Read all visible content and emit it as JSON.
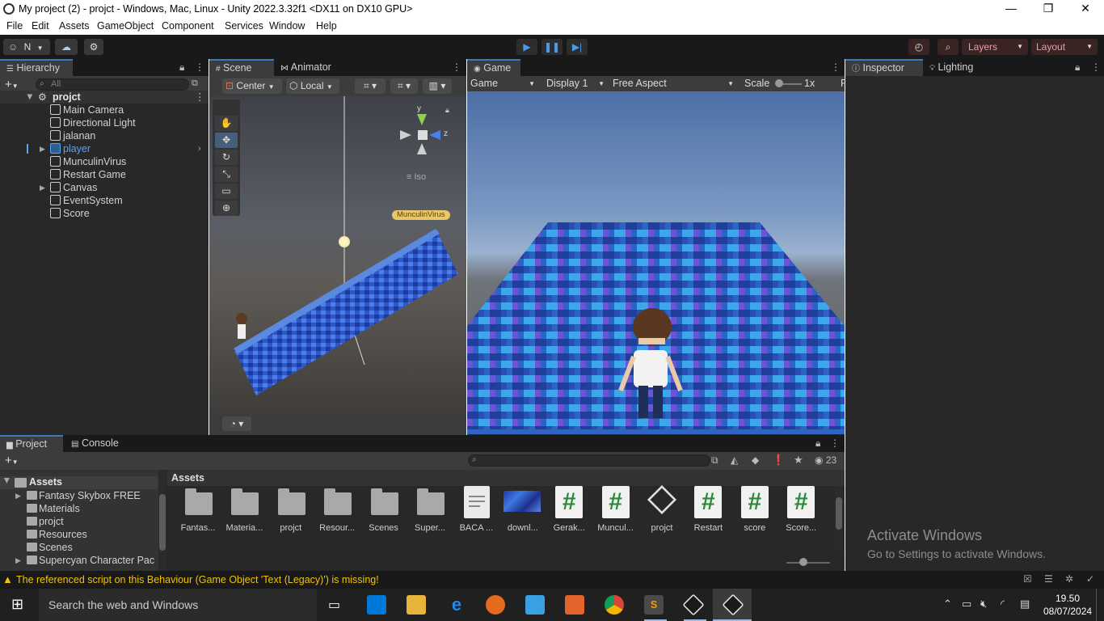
{
  "window": {
    "title": "My project (2) - projct - Windows, Mac, Linux - Unity 2022.3.32f1 <DX11 on DX10 GPU>",
    "minimize": "—",
    "maximize": "❐",
    "close": "✕"
  },
  "menu": [
    "File",
    "Edit",
    "Assets",
    "GameObject",
    "Component",
    "Services",
    "Window",
    "Help"
  ],
  "toolbar": {
    "account_initial": "N",
    "layers_label": "Layers",
    "layout_label": "Layout"
  },
  "hierarchy": {
    "tab": "Hierarchy",
    "search_placeholder": "All",
    "scene_name": "projct",
    "items": [
      {
        "label": "Main Camera",
        "selected": false,
        "expandable": false
      },
      {
        "label": "Directional Light",
        "selected": false,
        "expandable": false
      },
      {
        "label": "jalanan",
        "selected": false,
        "expandable": false
      },
      {
        "label": "player",
        "selected": true,
        "expandable": true
      },
      {
        "label": "MunculinVirus",
        "selected": false,
        "expandable": false
      },
      {
        "label": "Restart Game",
        "selected": false,
        "expandable": false
      },
      {
        "label": "Canvas",
        "selected": false,
        "expandable": true
      },
      {
        "label": "EventSystem",
        "selected": false,
        "expandable": false
      },
      {
        "label": "Score",
        "selected": false,
        "expandable": false
      }
    ]
  },
  "scene": {
    "tab_scene": "Scene",
    "tab_animator": "Animator",
    "pivot": "Center",
    "space": "Local",
    "gizmo_y": "y",
    "gizmo_z": "z",
    "gizmo_mode": "Iso",
    "object_label": "MunculinVirus"
  },
  "game": {
    "tab": "Game",
    "mode": "Game",
    "display": "Display 1",
    "aspect": "Free Aspect",
    "scale_label": "Scale",
    "scale_value": "1x",
    "extra": "P"
  },
  "inspector": {
    "tab_inspector": "Inspector",
    "tab_lighting": "Lighting",
    "watermark_title": "Activate Windows",
    "watermark_sub": "Go to Settings to activate Windows."
  },
  "project": {
    "tab_project": "Project",
    "tab_console": "Console",
    "hidden_count": "23",
    "tree_root": "Assets",
    "tree": [
      "Fantasy Skybox FREE",
      "Materials",
      "projct",
      "Resources",
      "Scenes",
      "Supercyan Character Pac"
    ],
    "breadcrumb": "Assets",
    "assets": [
      {
        "label": "Fantas...",
        "kind": "folder"
      },
      {
        "label": "Materia...",
        "kind": "folder"
      },
      {
        "label": "projct",
        "kind": "folder"
      },
      {
        "label": "Resour...",
        "kind": "folder"
      },
      {
        "label": "Scenes",
        "kind": "folder"
      },
      {
        "label": "Super...",
        "kind": "folder"
      },
      {
        "label": "BACA ...",
        "kind": "doc"
      },
      {
        "label": "downl...",
        "kind": "texture"
      },
      {
        "label": "Gerak...",
        "kind": "script"
      },
      {
        "label": "Muncul...",
        "kind": "script"
      },
      {
        "label": "projct",
        "kind": "unity"
      },
      {
        "label": "Restart",
        "kind": "script"
      },
      {
        "label": "score",
        "kind": "script"
      },
      {
        "label": "Score...",
        "kind": "script"
      }
    ]
  },
  "status": {
    "message": "The referenced script on this Behaviour (Game Object 'Text (Legacy)') is missing!"
  },
  "taskbar": {
    "search_placeholder": "Search the web and Windows",
    "time": "19.50",
    "date": "08/07/2024"
  },
  "colors": {
    "accent": "#3a79bb",
    "selection_text": "#5aa5f0",
    "warning": "#f2c300",
    "panel": "#282828",
    "tabbar": "#191919"
  }
}
